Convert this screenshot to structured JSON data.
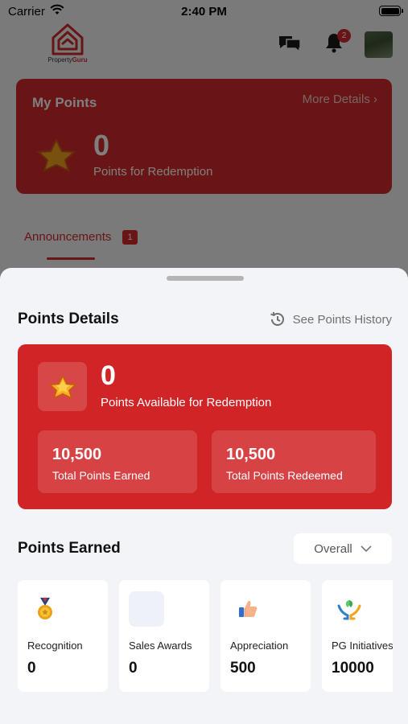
{
  "status_bar": {
    "carrier": "Carrier",
    "time": "2:40 PM"
  },
  "header": {
    "brand_prefix": "Property",
    "brand_suffix": "Guru",
    "notification_count": "2"
  },
  "my_points": {
    "title": "My Points",
    "more_details": "More Details",
    "value": "0",
    "label": "Points for Redemption"
  },
  "tabs": {
    "announcements": "Announcements",
    "announcements_count": "1"
  },
  "sheet": {
    "title": "Points Details",
    "history_link": "See Points History",
    "available_value": "0",
    "available_label": "Points Available for Redemption",
    "earned_total": "10,500",
    "earned_label": "Total Points Earned",
    "redeemed_total": "10,500",
    "redeemed_label": "Total Points Redeemed",
    "earned_section_title": "Points Earned",
    "filter_value": "Overall",
    "categories": [
      {
        "name": "Recognition",
        "value": "0",
        "icon": "medal-icon"
      },
      {
        "name": "Sales Awards",
        "value": "0",
        "icon": "placeholder-icon"
      },
      {
        "name": "Appreciation",
        "value": "500",
        "icon": "thumbs-up-icon"
      },
      {
        "name": "PG Initiatives",
        "value": "10000",
        "icon": "hands-leaf-icon"
      }
    ]
  },
  "colors": {
    "brand_red": "#d12426",
    "sheet_bg": "#f2f4f8"
  }
}
